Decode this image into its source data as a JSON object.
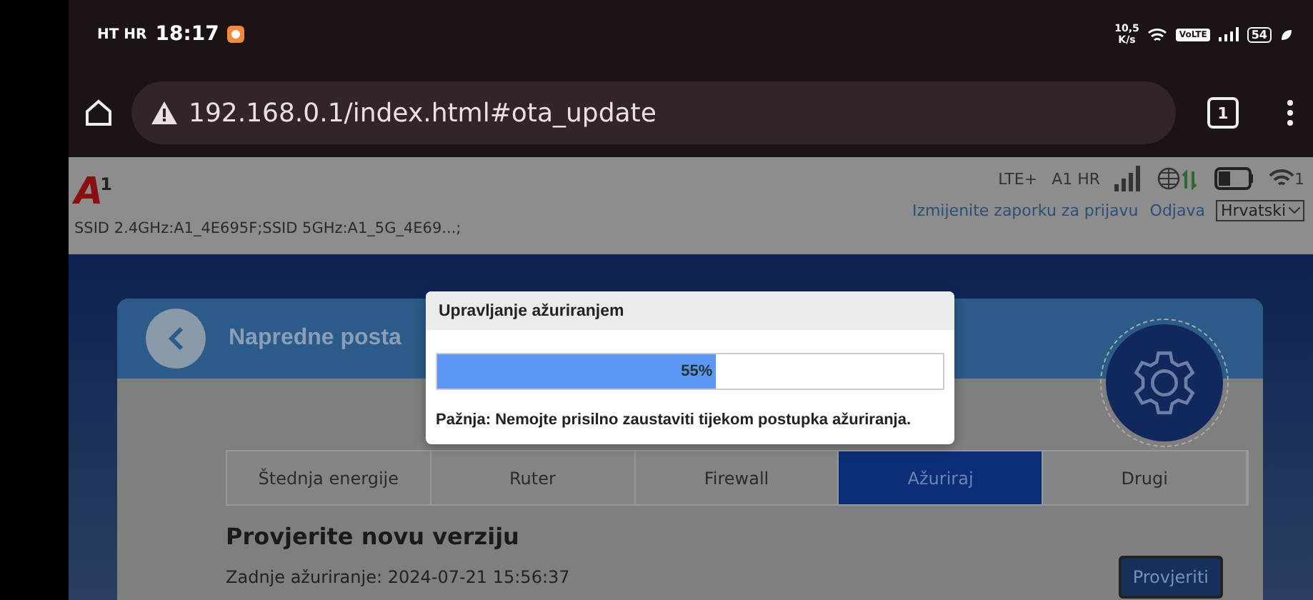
{
  "status_bar": {
    "carrier": "HT HR",
    "time": "18:17",
    "speed": "10,5",
    "speed_unit": "K/s",
    "volte": "VoLTE",
    "battery": "54"
  },
  "browser": {
    "url": "192.168.0.1/index.html#ota_update",
    "tab_count": "1"
  },
  "router_header": {
    "logo": "A",
    "logo_sup": "1",
    "ssid": "SSID 2.4GHz:A1_4E695F;SSID 5GHz:A1_5G_4E69...;",
    "network": "LTE+",
    "operator": "A1 HR",
    "wifi_clients": "1",
    "links": [
      "Izmijenite zaporku za prijavu",
      "Odjava"
    ],
    "language": "Hrvatski"
  },
  "card": {
    "title": "Napredne posta",
    "tabs": [
      {
        "label": "Štednja energije",
        "selected": false
      },
      {
        "label": "Ruter",
        "selected": false
      },
      {
        "label": "Firewall",
        "selected": false
      },
      {
        "label": "Ažuriraj",
        "selected": true
      },
      {
        "label": "Drugi",
        "selected": false
      }
    ],
    "section_title": "Provjerite novu verziju",
    "last_update": "Zadnje ažuriranje: 2024-07-21 15:56:37",
    "button": "Provjeriti"
  },
  "dialog": {
    "title": "Upravljanje ažuriranjem",
    "level": 0.55,
    "percent": "55%",
    "warning": "Pažnja: Nemojte prisilno zaustaviti tijekom postupka ažuriranja."
  }
}
